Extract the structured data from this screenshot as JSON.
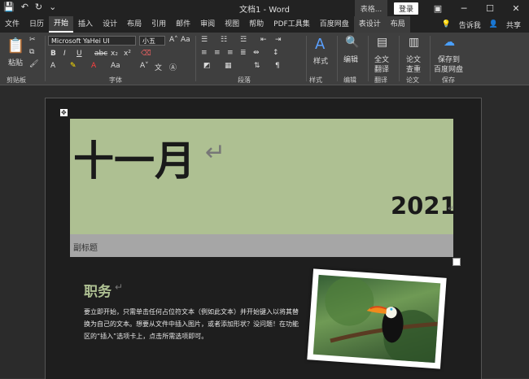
{
  "window": {
    "doc_title": "文档1 - Word",
    "table_tools": "表格...",
    "login": "登录"
  },
  "tabs": [
    {
      "label": "文件"
    },
    {
      "label": "日历"
    },
    {
      "label": "开始"
    },
    {
      "label": "插入"
    },
    {
      "label": "设计"
    },
    {
      "label": "布局"
    },
    {
      "label": "引用"
    },
    {
      "label": "邮件"
    },
    {
      "label": "审阅"
    },
    {
      "label": "视图"
    },
    {
      "label": "帮助"
    },
    {
      "label": "PDF工具集"
    },
    {
      "label": "百度网盘"
    },
    {
      "label": "表设计"
    },
    {
      "label": "布局"
    }
  ],
  "tabs_right": {
    "tell_me": "告诉我",
    "share": "共享"
  },
  "ribbon": {
    "font_name": "Microsoft YaHei UI",
    "font_size": "小五",
    "groups": {
      "clipboard": "剪贴板",
      "font": "字体",
      "paragraph": "段落",
      "styles": "样式",
      "edit": "编辑",
      "translate": "翻译",
      "paper": "论文",
      "save": "保存"
    },
    "buttons": {
      "paste": "粘贴",
      "styles": "样式",
      "edit": "编辑",
      "fulltext1": "全文",
      "fulltext2": "翻译",
      "paper1": "论文",
      "paper2": "查重",
      "save1": "保存到",
      "save2": "百度网盘"
    }
  },
  "document": {
    "month": "十一月",
    "year": "2021",
    "subtitle": "副标题",
    "section": "职务",
    "body": "要立即开始，只需单击任何占位符文本（例如此文本）并开始键入以将其替换为自己的文本。想要从文件中插入图片，或者添加形状？没问题！在功能区的“插入”选项卡上，点击所需选项即可。"
  }
}
